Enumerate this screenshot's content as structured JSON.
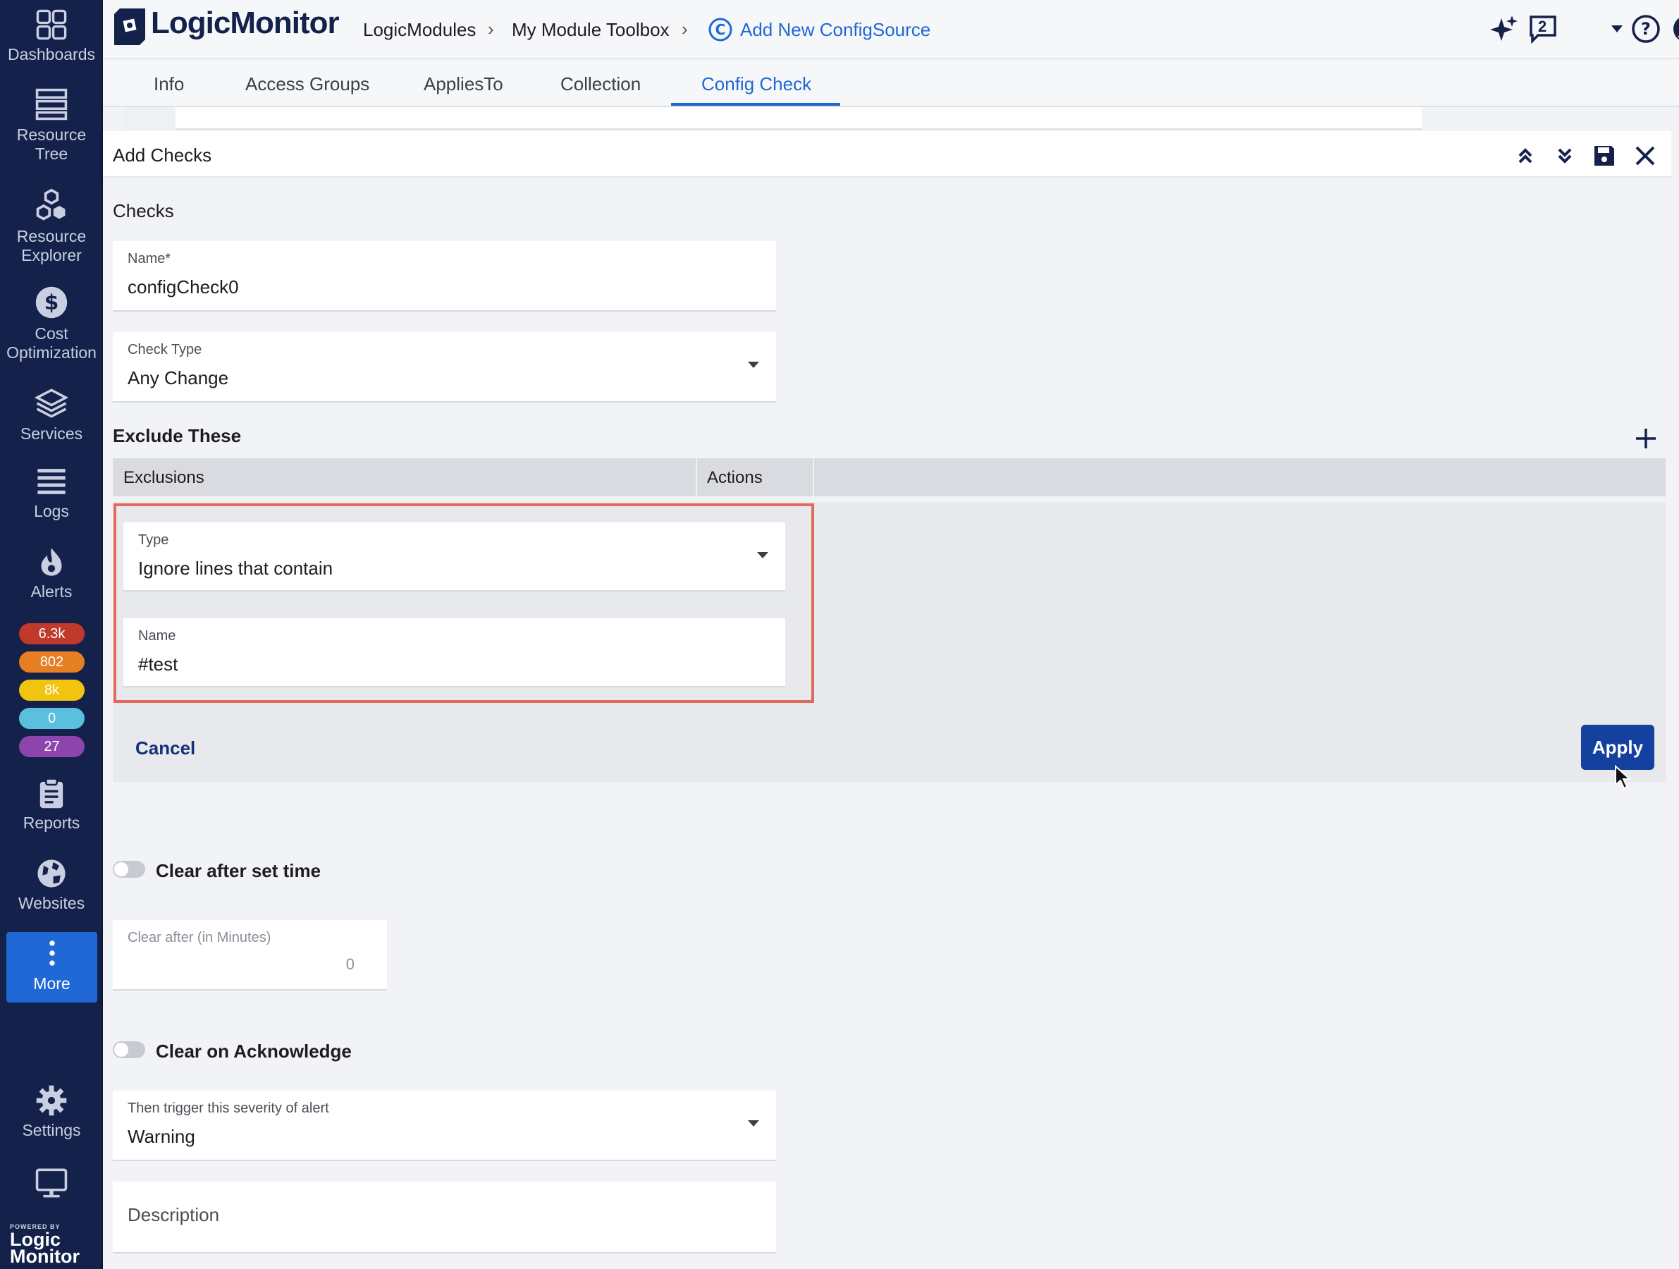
{
  "sidebar": {
    "items": [
      {
        "label": "Dashboards",
        "icon": "dashboards-icon"
      },
      {
        "label": "Resource Tree",
        "icon": "resource-tree-icon"
      },
      {
        "label": "Resource Explorer",
        "icon": "resource-explorer-icon"
      },
      {
        "label": "Cost Optimization",
        "icon": "dollar-icon"
      },
      {
        "label": "Services",
        "icon": "layers-icon"
      },
      {
        "label": "Logs",
        "icon": "logs-icon"
      },
      {
        "label": "Alerts",
        "icon": "flame-icon"
      },
      {
        "label": "Reports",
        "icon": "clipboard-icon"
      },
      {
        "label": "Websites",
        "icon": "globe-icon"
      },
      {
        "label": "More",
        "icon": "more-vertical-icon"
      },
      {
        "label": "Settings",
        "icon": "gear-icon"
      }
    ],
    "alert_counts": [
      {
        "value": "6.3k",
        "color": "#c0392b"
      },
      {
        "value": "802",
        "color": "#e67e22"
      },
      {
        "value": "8k",
        "color": "#f1c40f"
      },
      {
        "value": "0",
        "color": "#5bc0de"
      },
      {
        "value": "27",
        "color": "#8e44ad"
      }
    ],
    "brand": {
      "powered": "POWERED BY",
      "line1": "Logic",
      "line2": "Monitor"
    }
  },
  "header": {
    "logo": "LogicMonitor",
    "breadcrumb": [
      "LogicModules",
      "My Module Toolbox",
      "Add New ConfigSource"
    ],
    "notification_count": "2"
  },
  "tabs": [
    "Info",
    "Access Groups",
    "AppliesTo",
    "Collection",
    "Config Check"
  ],
  "panel": {
    "title": "Add Checks",
    "checks_label": "Checks",
    "name_field": {
      "label": "Name*",
      "value": "configCheck0"
    },
    "check_type_field": {
      "label": "Check Type",
      "value": "Any Change"
    },
    "exclude_label": "Exclude These",
    "table": {
      "columns": [
        "Exclusions",
        "Actions"
      ]
    },
    "exclusion_type": {
      "label": "Type",
      "value": "Ignore lines that contain"
    },
    "exclusion_name": {
      "label": "Name",
      "value": "#test"
    },
    "cancel_label": "Cancel",
    "apply_label": "Apply",
    "clear_after_toggle": "Clear after set time",
    "clear_after_field": {
      "label": "Clear after (in Minutes)",
      "value": "0"
    },
    "clear_on_ack_toggle": "Clear on Acknowledge",
    "severity_field": {
      "label": "Then trigger this severity of alert",
      "value": "Warning"
    },
    "description_placeholder": "Description"
  },
  "colors": {
    "accent": "#1f68d6",
    "sidebar_bg": "#14214a",
    "highlight": "#e06a5c",
    "apply": "#1440a0"
  }
}
